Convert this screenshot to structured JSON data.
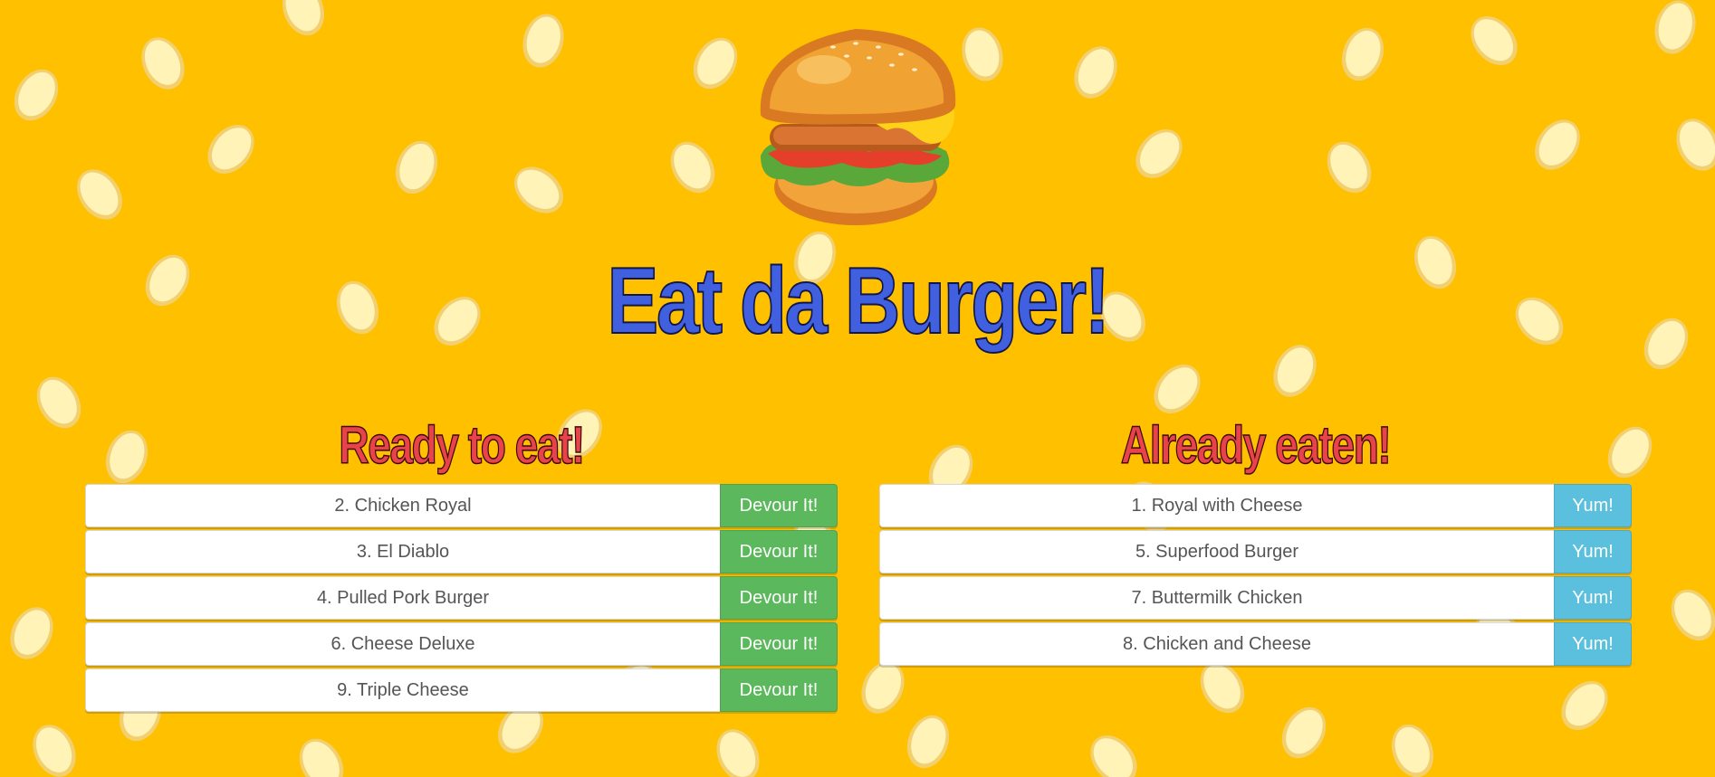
{
  "app": {
    "title": "Eat da Burger!",
    "logo_icon": "burger-icon",
    "background_color": "#ffc000",
    "title_color": "#4160e0",
    "heading_color": "#e8424a"
  },
  "ready": {
    "heading": "Ready to eat!",
    "button_label": "Devour It!",
    "button_color": "#5cb85c",
    "items": [
      {
        "label": "2. Chicken Royal"
      },
      {
        "label": "3. El Diablo"
      },
      {
        "label": "4. Pulled Pork Burger"
      },
      {
        "label": "6. Cheese Deluxe"
      },
      {
        "label": "9. Triple Cheese"
      }
    ]
  },
  "eaten": {
    "heading": "Already eaten!",
    "button_label": "Yum!",
    "button_color": "#5bc0de",
    "items": [
      {
        "label": "1. Royal with Cheese"
      },
      {
        "label": "5. Superfood Burger"
      },
      {
        "label": "7. Buttermilk Chicken"
      },
      {
        "label": "8. Chicken and Cheese"
      }
    ]
  }
}
